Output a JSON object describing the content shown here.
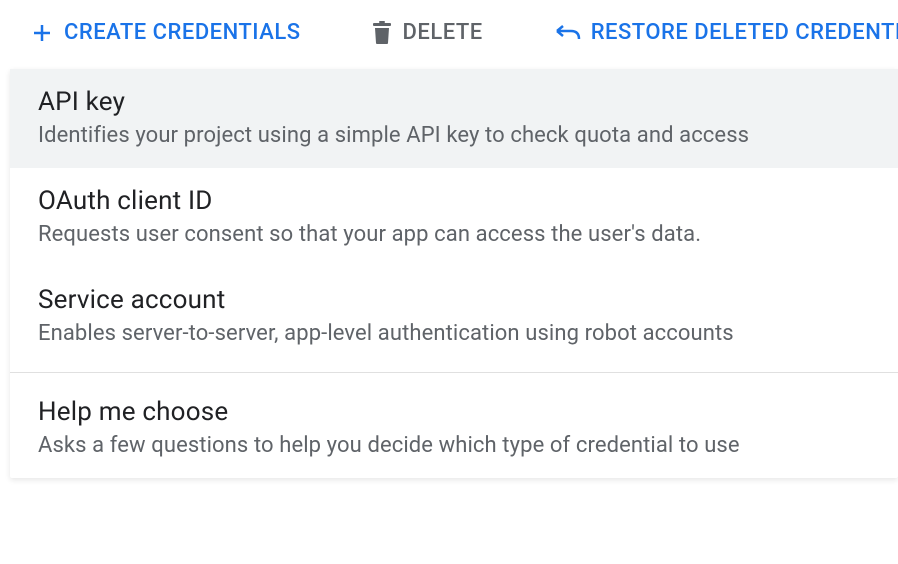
{
  "toolbar": {
    "create_label": "CREATE CREDENTIALS",
    "delete_label": "DELETE",
    "restore_label": "RESTORE DELETED CREDENTIALS"
  },
  "menu": {
    "items": [
      {
        "title": "API key",
        "desc": "Identifies your project using a simple API key to check quota and access"
      },
      {
        "title": "OAuth client ID",
        "desc": "Requests user consent so that your app can access the user's data."
      },
      {
        "title": "Service account",
        "desc": "Enables server-to-server, app-level authentication using robot accounts"
      }
    ],
    "help": {
      "title": "Help me choose",
      "desc": "Asks a few questions to help you decide which type of credential to use"
    }
  },
  "colors": {
    "primary": "#1a73e8",
    "secondary": "#5f6368",
    "text": "#202124",
    "highlight": "#f1f3f4"
  }
}
